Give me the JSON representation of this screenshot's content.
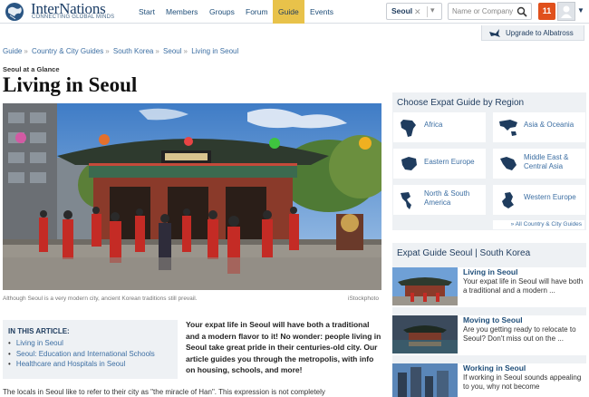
{
  "logo": {
    "name": "InterNations",
    "tagline": "CONNECTING GLOBAL MINDS"
  },
  "nav": {
    "items": [
      {
        "label": "Start",
        "active": false
      },
      {
        "label": "Members",
        "active": false
      },
      {
        "label": "Groups",
        "active": false
      },
      {
        "label": "Forum",
        "active": false
      },
      {
        "label": "Guide",
        "active": true
      },
      {
        "label": "Events",
        "active": false
      }
    ],
    "city": "Seoul",
    "search_placeholder": "Name or Company",
    "notification_count": "11"
  },
  "upgrade": {
    "label": "Upgrade to Albatross"
  },
  "breadcrumb": [
    "Guide",
    "Country & City Guides",
    "South Korea",
    "Seoul",
    "Living in Seoul"
  ],
  "article": {
    "kicker": "Seoul at a Glance",
    "title": "Living in Seoul",
    "caption": "Although Seoul is a very modern city, ancient Korean traditions still prevail.",
    "credit": "iStockphoto",
    "toc_heading": "IN THIS ARTICLE:",
    "toc": [
      "Living in Seoul",
      "Seoul: Education and International Schools",
      "Healthcare and Hospitals in Seoul"
    ],
    "intro": "Your expat life in Seoul will have both a traditional and a modern flavor to it! No wonder: people living in Seoul take great pride in their centuries-old city. Our article guides you through the metropolis, with info on housing, schools, and more!",
    "body": "The locals in Seoul like to refer to their city as \"the miracle of Han\". This expression is not completely"
  },
  "regions": {
    "heading": "Choose Expat Guide by Region",
    "items": [
      {
        "label": "Africa",
        "icon": "africa-map-icon"
      },
      {
        "label": "Asia & Oceania",
        "icon": "asia-map-icon"
      },
      {
        "label": "Eastern Europe",
        "icon": "eastern-europe-map-icon"
      },
      {
        "label": "Middle East & Central Asia",
        "icon": "middle-east-map-icon"
      },
      {
        "label": "North & South America",
        "icon": "americas-map-icon"
      },
      {
        "label": "Western Europe",
        "icon": "western-europe-map-icon"
      }
    ],
    "all_link": "» All Country & City Guides"
  },
  "guides": {
    "heading": "Expat Guide Seoul | South Korea",
    "items": [
      {
        "title": "Living in Seoul",
        "desc": "Your expat life in Seoul will have both a traditional and a modern ..."
      },
      {
        "title": "Moving to Seoul",
        "desc": "Are you getting ready to relocate to Seoul? Don't miss out on the ..."
      },
      {
        "title": "Working in Seoul",
        "desc": "If working in Seoul sounds appealing to you, why not become"
      }
    ]
  },
  "colors": {
    "brand": "#1f3c5e",
    "link": "#3d6fa3",
    "accent": "#e8c24a",
    "notification": "#e0501c",
    "panel": "#eef1f4"
  }
}
